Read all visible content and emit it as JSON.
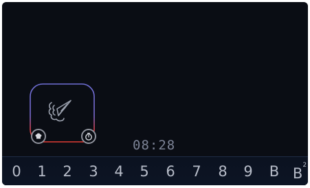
{
  "function_card": {
    "icon": "steam-icon",
    "left_badge_icon": "chef-hat-icon",
    "right_badge_icon": "timer-icon",
    "colors": {
      "top_border": "#6f6fd6",
      "bottom_border": "#e23b33"
    }
  },
  "clock": {
    "time": "08:28"
  },
  "levels": [
    {
      "label": "0"
    },
    {
      "label": "1"
    },
    {
      "label": "2"
    },
    {
      "label": "3"
    },
    {
      "label": "4"
    },
    {
      "label": "5"
    },
    {
      "label": "6"
    },
    {
      "label": "7"
    },
    {
      "label": "8"
    },
    {
      "label": "9"
    },
    {
      "label": "B"
    },
    {
      "label": "B",
      "superscript": "2"
    }
  ]
}
